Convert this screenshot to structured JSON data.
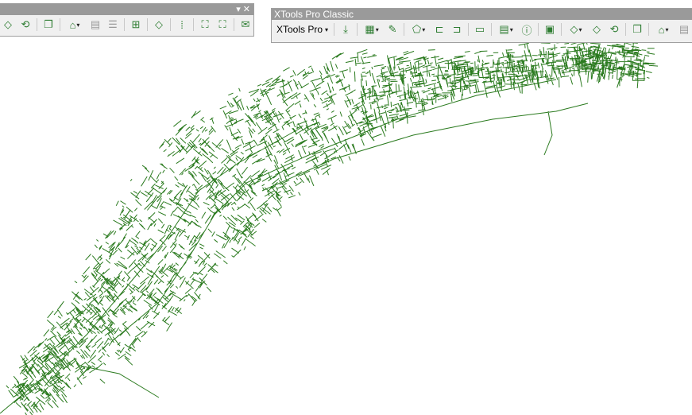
{
  "left_toolbar": {
    "buttons": [
      {
        "icon": "polygon-edit-icon",
        "dd": false,
        "gray": false
      },
      {
        "icon": "polygon-convert-icon",
        "dd": false,
        "gray": false
      },
      {
        "icon": "copy-layers-icon",
        "dd": false,
        "gray": false
      },
      {
        "icon": "table-tools-icon",
        "dd": true,
        "gray": false
      },
      {
        "icon": "paste-icon",
        "dd": false,
        "gray": true
      },
      {
        "icon": "export-table-icon",
        "dd": false,
        "gray": true
      },
      {
        "icon": "add-feature-icon",
        "dd": false,
        "gray": false
      },
      {
        "icon": "diamond-icon",
        "dd": false,
        "gray": false
      },
      {
        "icon": "grid-split-icon",
        "dd": false,
        "gray": false
      },
      {
        "icon": "map-add-icon",
        "dd": false,
        "gray": false
      },
      {
        "icon": "map-remove-icon",
        "dd": false,
        "gray": false
      },
      {
        "icon": "mail-icon",
        "dd": false,
        "gray": false
      }
    ],
    "controls": "▾ ✕"
  },
  "xtools_toolbar": {
    "title": "XTools Pro Classic",
    "menu_label": "XTools Pro",
    "buttons": [
      {
        "icon": "download-icon",
        "dd": false,
        "gray": false
      },
      {
        "icon": "table-grid-icon",
        "dd": true,
        "gray": false
      },
      {
        "icon": "pencil-icon",
        "dd": false,
        "gray": false
      },
      {
        "icon": "polygon-tools-icon",
        "dd": true,
        "gray": false
      },
      {
        "icon": "shape-split-icon",
        "dd": false,
        "gray": false
      },
      {
        "icon": "shape-merge-icon",
        "dd": false,
        "gray": false
      },
      {
        "icon": "callout-icon",
        "dd": false,
        "gray": false
      },
      {
        "icon": "table-export-icon",
        "dd": true,
        "gray": false
      },
      {
        "icon": "info-icon",
        "dd": false,
        "gray": false
      },
      {
        "icon": "form-icon",
        "dd": false,
        "gray": false
      },
      {
        "icon": "polygon-edit-icon",
        "dd": true,
        "gray": false
      },
      {
        "icon": "polygon-outline-icon",
        "dd": false,
        "gray": false
      },
      {
        "icon": "polygon-convert-icon",
        "dd": false,
        "gray": false
      },
      {
        "icon": "copy-layers-icon",
        "dd": false,
        "gray": false
      },
      {
        "icon": "table-tools-icon",
        "dd": true,
        "gray": false
      },
      {
        "icon": "paste-icon",
        "dd": false,
        "gray": true
      }
    ]
  },
  "map": {
    "line_color": "#2a7a1e"
  }
}
